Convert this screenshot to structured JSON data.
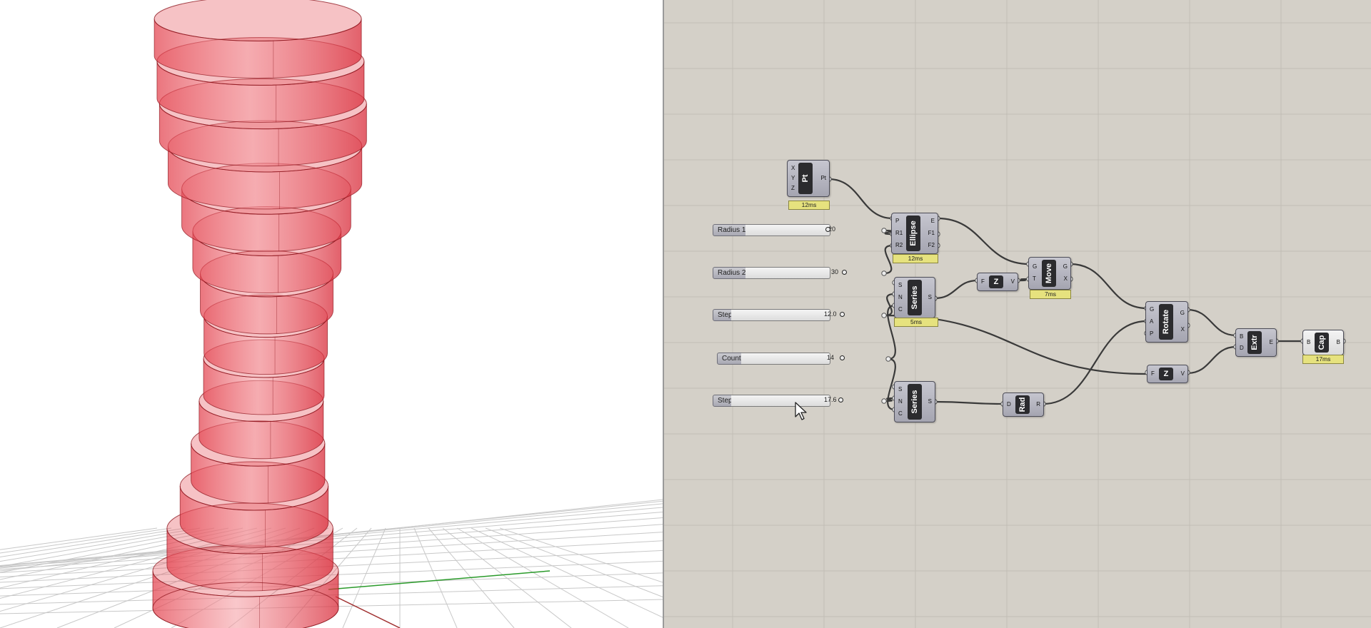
{
  "viewport": {
    "name": "rhino-perspective-viewport",
    "colors": {
      "band_fill": "#e6505a",
      "band_edge": "#8a1018",
      "grid_line": "#c8c8c8",
      "y_axis": "#2a9a2a",
      "x_axis": "#a03030"
    },
    "tower": {
      "ring_count": 14
    }
  },
  "canvas": {
    "background": "#d4d0c8",
    "sliders": [
      {
        "id": "radius1",
        "label": "Radius 1",
        "value": "20",
        "knob_fraction": 0.45
      },
      {
        "id": "radius2",
        "label": "Radius 2",
        "value": "30",
        "knob_fraction": 0.53
      },
      {
        "id": "step1",
        "label": "Step",
        "value": "12.0",
        "knob_fraction": 0.62
      },
      {
        "id": "count",
        "label": "Count",
        "value": "14",
        "knob_fraction": 0.67
      },
      {
        "id": "step2",
        "label": "Step",
        "value": "17.6",
        "knob_fraction": 0.59
      }
    ],
    "components": {
      "pt": {
        "name": "Pt",
        "inputs": [
          "X",
          "Y",
          "Z"
        ],
        "outputs": [
          "Pt"
        ],
        "timing": "12ms"
      },
      "ellipse": {
        "name": "Ellipse",
        "inputs": [
          "P",
          "R1",
          "R2"
        ],
        "outputs": [
          "E",
          "F1",
          "F2"
        ],
        "timing": "12ms"
      },
      "series1": {
        "name": "Series",
        "inputs": [
          "S",
          "N",
          "C"
        ],
        "outputs": [
          "S"
        ],
        "timing": "5ms"
      },
      "series2": {
        "name": "Series",
        "inputs": [
          "S",
          "N",
          "C"
        ],
        "outputs": [
          "S"
        ]
      },
      "z1": {
        "name": "Z",
        "inputs": [
          "F"
        ],
        "outputs": [
          "V"
        ]
      },
      "z2": {
        "name": "Z",
        "inputs": [
          "F"
        ],
        "outputs": [
          "V"
        ]
      },
      "move": {
        "name": "Move",
        "inputs": [
          "G",
          "T"
        ],
        "outputs": [
          "G",
          "X"
        ],
        "timing": "7ms"
      },
      "rad": {
        "name": "Rad",
        "inputs": [
          "D"
        ],
        "outputs": [
          "R"
        ]
      },
      "rotate": {
        "name": "Rotate",
        "inputs": [
          "G",
          "A",
          "P"
        ],
        "outputs": [
          "G",
          "X"
        ]
      },
      "extr": {
        "name": "Extr",
        "inputs": [
          "B",
          "D"
        ],
        "outputs": [
          "E"
        ]
      },
      "cap": {
        "name": "Cap",
        "inputs": [
          "B"
        ],
        "outputs": [
          "B"
        ],
        "timing": "17ms"
      }
    }
  }
}
